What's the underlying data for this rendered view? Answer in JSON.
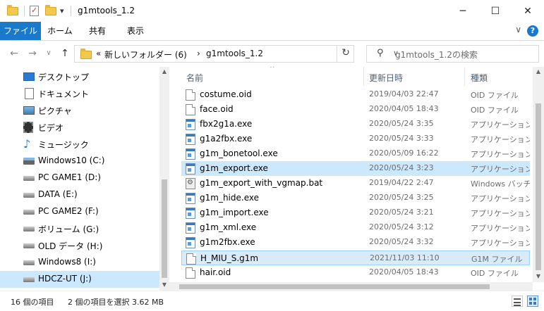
{
  "window": {
    "title": "g1mtools_1.2",
    "minimize": "─",
    "maximize": "☐",
    "close": "✕"
  },
  "quick_access": {
    "pin": "✓",
    "dropdown": "▾"
  },
  "ribbon": {
    "tabs": [
      "ファイル",
      "ホーム",
      "共有",
      "表示"
    ],
    "collapse": "∨",
    "help": "?"
  },
  "nav": {
    "back": "←",
    "forward": "→",
    "recent": "∨",
    "up": "↑",
    "breadcrumb": {
      "overflow": "«",
      "parent": "新しいフォルダー (6)",
      "sep": "›",
      "current": "g1mtools_1.2",
      "dropdown": "∨"
    },
    "refresh": "↻",
    "search_placeholder": "g1mtools_1.2の検索"
  },
  "sidebar": {
    "items": [
      {
        "label": "デスクトップ",
        "icon": "desktop-icon"
      },
      {
        "label": "ドキュメント",
        "icon": "documents-icon"
      },
      {
        "label": "ピクチャ",
        "icon": "pictures-icon"
      },
      {
        "label": "ビデオ",
        "icon": "videos-icon"
      },
      {
        "label": "ミュージック",
        "icon": "music-icon"
      },
      {
        "label": "Windows10 (C:)",
        "icon": "drive-icon"
      },
      {
        "label": "PC GAME1 (D:)",
        "icon": "drive-icon"
      },
      {
        "label": "DATA (E:)",
        "icon": "drive-icon"
      },
      {
        "label": "PC GAME2 (F:)",
        "icon": "drive-icon"
      },
      {
        "label": "ボリューム (G:)",
        "icon": "drive-icon"
      },
      {
        "label": "OLD データ (H:)",
        "icon": "drive-icon"
      },
      {
        "label": "Windows8 (I:)",
        "icon": "drive-icon"
      },
      {
        "label": "HDCZ-UT (J:)",
        "icon": "drive-icon",
        "selected": true
      }
    ]
  },
  "columns": {
    "name": "名前",
    "modified": "更新日時",
    "type": "種類",
    "sort": "^"
  },
  "files": [
    {
      "name": "costume.oid",
      "date": "2019/04/03 22:47",
      "type": "OID ファイル",
      "kind": "doc"
    },
    {
      "name": "face.oid",
      "date": "2020/04/05 18:43",
      "type": "OID ファイル",
      "kind": "doc"
    },
    {
      "name": "fbx2g1a.exe",
      "date": "2020/05/24 3:35",
      "type": "アプリケーション",
      "kind": "exe"
    },
    {
      "name": "g1a2fbx.exe",
      "date": "2020/05/24 3:33",
      "type": "アプリケーション",
      "kind": "exe"
    },
    {
      "name": "g1m_bonetool.exe",
      "date": "2020/05/09 16:22",
      "type": "アプリケーション",
      "kind": "exe"
    },
    {
      "name": "g1m_export.exe",
      "date": "2020/05/24 3:23",
      "type": "アプリケーション",
      "kind": "exe",
      "selected": true
    },
    {
      "name": "g1m_export_with_vgmap.bat",
      "date": "2019/04/22 2:47",
      "type": "Windows バッチ ファイル",
      "kind": "bat"
    },
    {
      "name": "g1m_hide.exe",
      "date": "2020/05/24 3:25",
      "type": "アプリケーション",
      "kind": "exe"
    },
    {
      "name": "g1m_import.exe",
      "date": "2020/05/24 3:21",
      "type": "アプリケーション",
      "kind": "exe"
    },
    {
      "name": "g1m_xml.exe",
      "date": "2020/05/24 3:12",
      "type": "アプリケーション",
      "kind": "exe"
    },
    {
      "name": "g1m2fbx.exe",
      "date": "2020/05/24 3:32",
      "type": "アプリケーション",
      "kind": "exe"
    },
    {
      "name": "H_MIU_S.g1m",
      "date": "2021/11/03 11:10",
      "type": "G1M ファイル",
      "kind": "doc",
      "selected_focus": true
    },
    {
      "name": "hair.oid",
      "date": "2020/04/05 18:43",
      "type": "OID ファイル",
      "kind": "doc"
    }
  ],
  "scroll_arrows": {
    "up": "▲",
    "down": "▼"
  },
  "status": {
    "count": "16 個の項目",
    "selection": "2 個の項目を選択  3.62 MB"
  },
  "colors": {
    "accent": "#1979ca",
    "selection": "#cce8ff"
  }
}
